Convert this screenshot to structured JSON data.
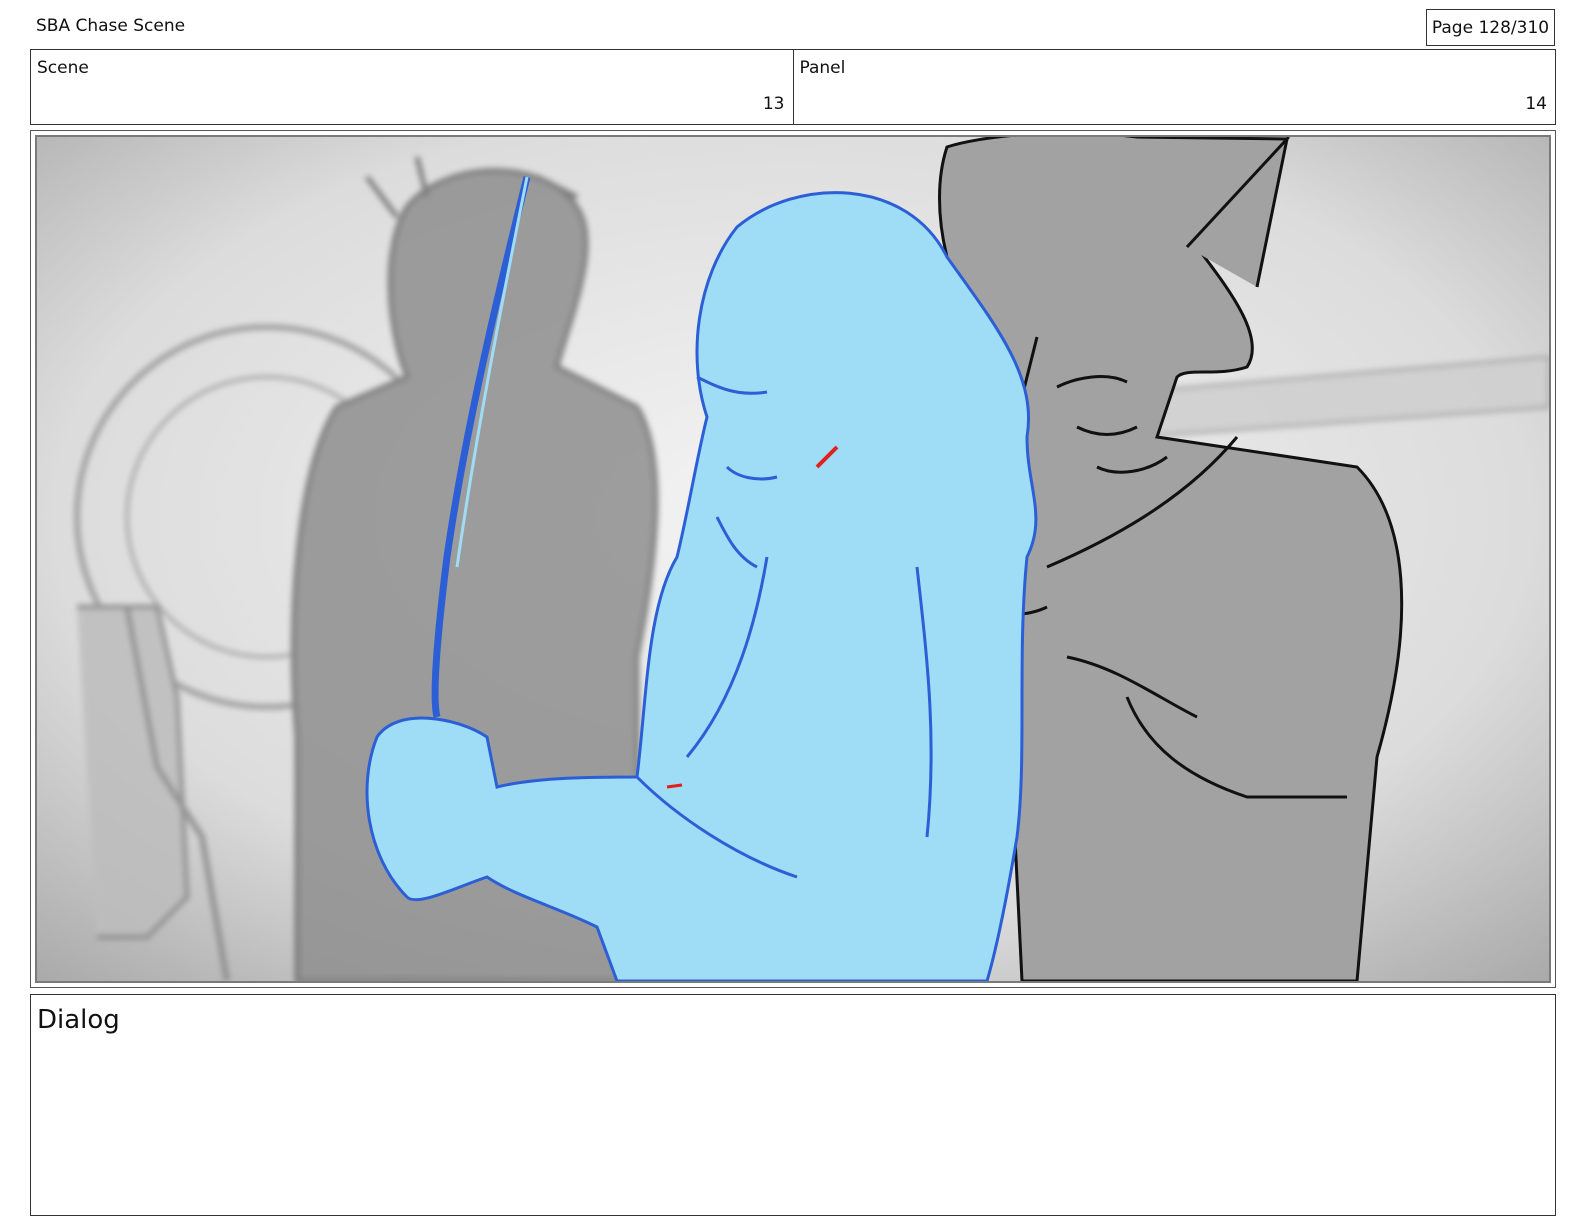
{
  "header": {
    "title": "SBA Chase Scene",
    "page": "Page 128/310"
  },
  "info": {
    "scene_label": "Scene",
    "scene_value": "13",
    "panel_label": "Panel",
    "panel_value": "14"
  },
  "dialog": {
    "label": "Dialog"
  },
  "colors": {
    "sketch_blue": "#9fdcf5",
    "sketch_blue_line": "#2c5fd6",
    "sketch_gray": "#a3a3a3",
    "accent_red": "#e0201b"
  }
}
